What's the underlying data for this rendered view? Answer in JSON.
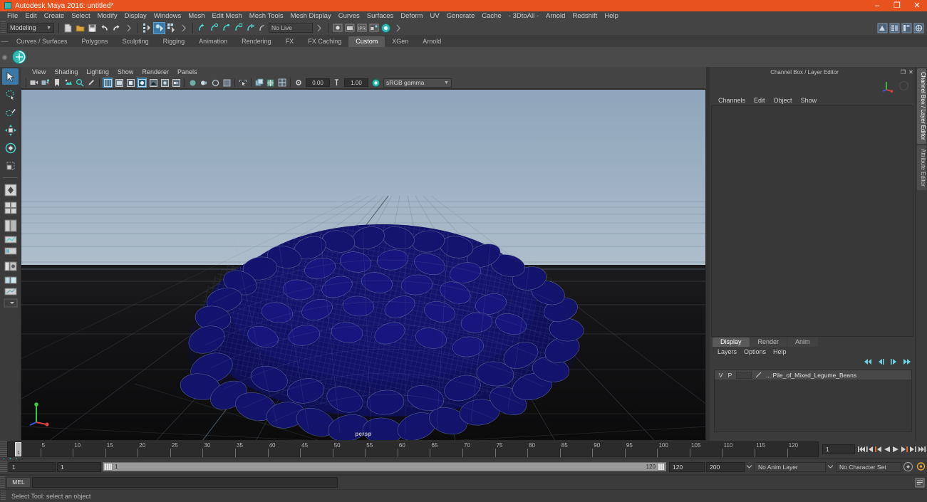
{
  "titlebar": {
    "title": "Autodesk Maya 2016: untitled*",
    "icon": "maya-logo-icon",
    "minimize": "–",
    "maximize": "❐",
    "close": "✕"
  },
  "menubar": {
    "items": [
      "File",
      "Edit",
      "Create",
      "Select",
      "Modify",
      "Display",
      "Windows",
      "Mesh",
      "Edit Mesh",
      "Mesh Tools",
      "Mesh Display",
      "Curves",
      "Surfaces",
      "Deform",
      "UV",
      "Generate",
      "Cache",
      "- 3DtoAll -",
      "Arnold",
      "Redshift",
      "Help"
    ]
  },
  "statusline": {
    "menuset": "Modeling",
    "live_surface": "No Live Surface",
    "arrow": "▼"
  },
  "shelf": {
    "tabs": [
      "Curves / Surfaces",
      "Polygons",
      "Sculpting",
      "Rigging",
      "Animation",
      "Rendering",
      "FX",
      "FX Caching",
      "Custom",
      "XGen",
      "Arnold"
    ],
    "active_tab": "Custom",
    "handle": "—"
  },
  "viewport": {
    "menus": [
      "View",
      "Shading",
      "Lighting",
      "Show",
      "Renderer",
      "Panels"
    ],
    "exposure": "0.00",
    "gamma_value": "1.00",
    "color_profile": "sRGB gamma",
    "camera_label": "persp",
    "arrow": "▼"
  },
  "channelbox": {
    "title": "Channel Box / Layer Editor",
    "menus": [
      "Channels",
      "Edit",
      "Object",
      "Show"
    ],
    "undock": "❐",
    "close": "✕"
  },
  "layereditor": {
    "tabs": [
      "Display",
      "Render",
      "Anim"
    ],
    "active_tab": "Display",
    "menus": [
      "Layers",
      "Options",
      "Help"
    ],
    "columns": [
      "V",
      "P"
    ],
    "layers": [
      {
        "visible": "V",
        "playback": "P",
        "name": "...:Pile_of_Mixed_Legume_Beans"
      }
    ]
  },
  "vertical_tabs": {
    "items": [
      "Channel Box / Layer Editor",
      "Attribute Editor"
    ],
    "active": "Channel Box / Layer Editor"
  },
  "timeline": {
    "current_frame": "1",
    "ticks": [
      5,
      10,
      15,
      20,
      25,
      30,
      35,
      40,
      45,
      50,
      55,
      60,
      65,
      70,
      75,
      80,
      85,
      90,
      95,
      100,
      105,
      110,
      115,
      120
    ],
    "frame_field": "1",
    "transport": [
      "⏮",
      "⏴⏴",
      "⏴|",
      "◀",
      "▶",
      "|⏵",
      "⏵⏵",
      "⏭"
    ]
  },
  "rangeslider": {
    "anim_start": "1",
    "range_start": "1",
    "bar_start_label": "1",
    "bar_end_label": "120",
    "range_end": "120",
    "anim_end": "200",
    "anim_layer": "No Anim Layer",
    "character_set": "No Character Set",
    "arrow": "▼"
  },
  "commandline": {
    "language": "MEL",
    "input_value": "",
    "placeholder": ""
  },
  "helpline": {
    "text": "Select Tool: select an object"
  },
  "colors": {
    "title_bar": "#e8521f",
    "chrome": "#3b3b3b",
    "panel": "#444444",
    "accent_blue": "#3a78a8",
    "teal": "#2fb8b0",
    "mesh_wire": "#101060",
    "sky_top": "#8fa5bb",
    "ground": "#141416"
  }
}
